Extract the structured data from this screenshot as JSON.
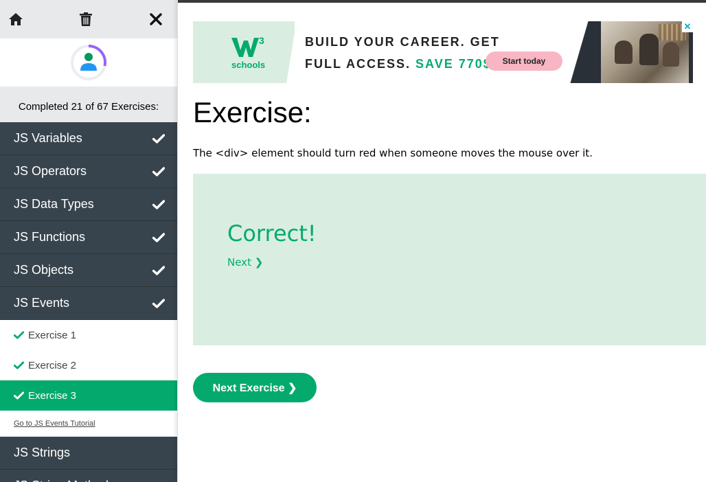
{
  "toolbar": {
    "home_icon": "home-icon",
    "trash_icon": "trash-icon",
    "close_icon": "close-icon"
  },
  "progress": {
    "text": "Completed 21 of 67 Exercises:",
    "completed": 21,
    "total": 67
  },
  "categories": [
    {
      "label": "JS Variables",
      "done": true
    },
    {
      "label": "JS Operators",
      "done": true
    },
    {
      "label": "JS Data Types",
      "done": true
    },
    {
      "label": "JS Functions",
      "done": true
    },
    {
      "label": "JS Objects",
      "done": true
    },
    {
      "label": "JS Events",
      "done": true
    }
  ],
  "events_exercises": [
    {
      "label": "Exercise 1",
      "active": false
    },
    {
      "label": "Exercise 2",
      "active": false
    },
    {
      "label": "Exercise 3",
      "active": true
    }
  ],
  "tutorial_link": "Go to JS Events Tutorial",
  "categories_after": [
    {
      "label": "JS Strings"
    },
    {
      "label": "JS String Methods"
    }
  ],
  "ad": {
    "logo_mark": "W",
    "logo_sup": "3",
    "logo_text": "schools",
    "line1": "BUILD YOUR CAREER. GET",
    "line2_a": "FULL ACCESS.",
    "line2_b": "SAVE 770$",
    "button": "Start today",
    "close": "✕"
  },
  "main": {
    "title": "Exercise:",
    "description": "The <div> element should turn red when someone moves the mouse over it.",
    "result_title": "Correct!",
    "next_link": "Next ❯",
    "next_exercise_button": "Next Exercise ❯"
  },
  "colors": {
    "accent": "#04aa6d",
    "sidebar_dark": "#38444d",
    "light_green": "#d9eee1"
  }
}
